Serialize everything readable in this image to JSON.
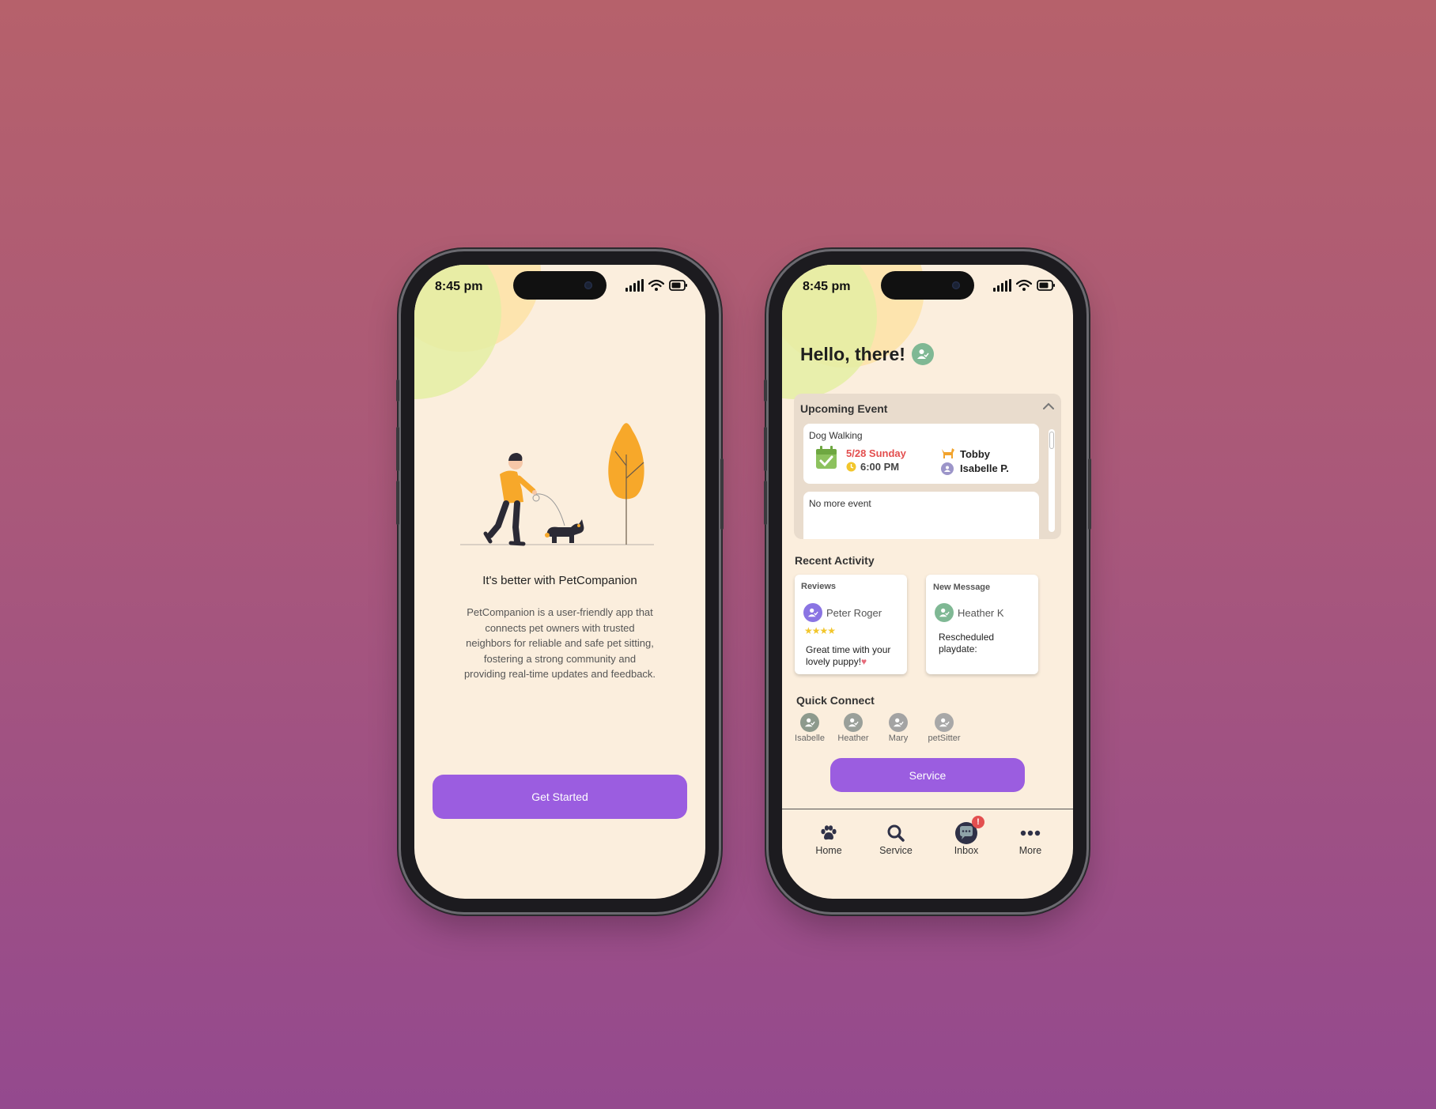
{
  "colors": {
    "accent": "#9b5de0",
    "screen_bg": "#fbeedd",
    "event_date": "#e34f4f",
    "avatar_green": "#7fb894",
    "avatar_purple": "#8a74e3",
    "avatar_gray": "#8d9a8d"
  },
  "status_bar": {
    "time": "8:45 pm"
  },
  "onboarding": {
    "illustration": "person-walking-dog-illustration",
    "title": "It's better with PetCompanion",
    "description": "PetCompanion is a user-friendly app that connects pet owners with trusted neighbors for reliable and safe pet sitting, fostering a strong community and providing real-time updates and feedback.",
    "cta_label": "Get Started"
  },
  "home": {
    "greeting": "Hello, there!",
    "upcoming": {
      "title": "Upcoming Event",
      "events": [
        {
          "type": "Dog Walking",
          "date": "5/28 Sunday",
          "time": "6:00 PM",
          "pet": "Tobby",
          "sitter": "Isabelle P."
        }
      ],
      "empty_text": "No more event"
    },
    "recent_activity": {
      "title": "Recent Activity",
      "review": {
        "label": "Reviews",
        "user": "Peter Roger",
        "stars": 4,
        "text": "Great time with your lovely puppy!"
      },
      "message": {
        "label": "New Message",
        "user": "Heather K",
        "text": "Rescheduled playdate:"
      }
    },
    "quick_connect": {
      "title": "Quick Connect",
      "contacts": [
        "Isabelle",
        "Heather",
        "Mary",
        "petSitter"
      ]
    },
    "service_label": "Service",
    "tabs": [
      {
        "label": "Home",
        "icon": "paw-icon"
      },
      {
        "label": "Service",
        "icon": "search-icon"
      },
      {
        "label": "Inbox",
        "icon": "chat-icon",
        "badge": "!"
      },
      {
        "label": "More",
        "icon": "more-dots-icon"
      }
    ]
  }
}
